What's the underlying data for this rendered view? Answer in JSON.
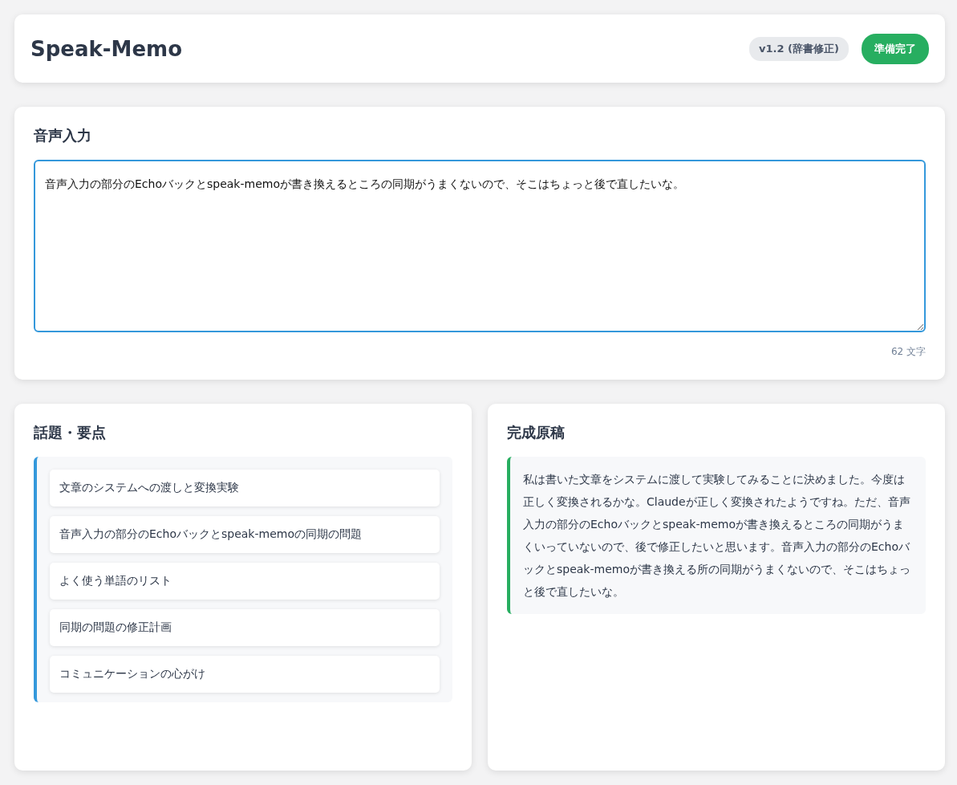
{
  "header": {
    "title": "Speak-Memo",
    "version": "v1.2 (辞書修正)",
    "status": "準備完了"
  },
  "input": {
    "title": "音声入力",
    "value": "音声入力の部分のEchoバックとspeak-memoが書き換えるところの同期がうまくないので、そこはちょっと後で直したいな。",
    "count": "62 文字"
  },
  "topics": {
    "title": "話題・要点",
    "items": [
      {
        "label": "文章のシステムへの渡しと変換実験"
      },
      {
        "label": "音声入力の部分のEchoバックとspeak-memoの同期の問題"
      },
      {
        "label": "よく使う単語のリスト"
      },
      {
        "label": "同期の問題の修正計画"
      },
      {
        "label": "コミュニケーションの心がけ"
      }
    ]
  },
  "draft": {
    "title": "完成原稿",
    "text": "私は書いた文章をシステムに渡して実験してみることに決めました。今度は正しく変換されるかな。Claudeが正しく変換されたようですね。ただ、音声入力の部分のEchoバックとspeak-memoが書き換えるところの同期がうまくいっていないので、後で修正したいと思います。音声入力の部分のEchoバックとspeak-memoが書き換える所の同期がうまくないので、そこはちょっと後で直したいな。"
  }
}
